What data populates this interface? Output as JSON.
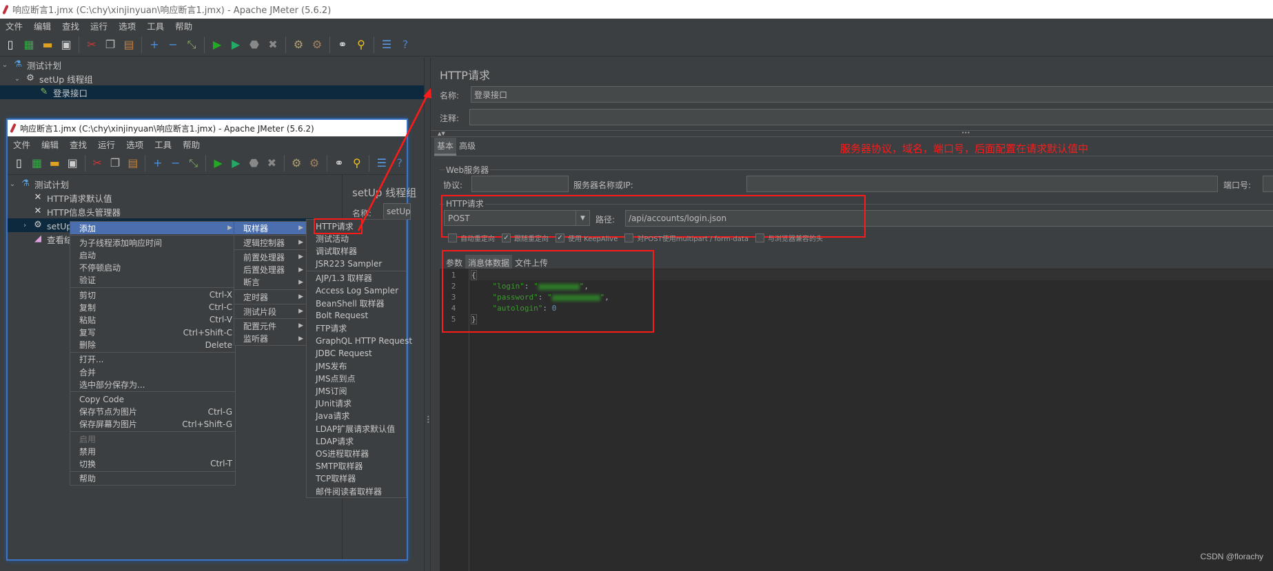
{
  "window": {
    "title": "响应断言1.jmx (C:\\chy\\xinjinyuan\\响应断言1.jmx) - Apache JMeter (5.6.2)"
  },
  "menubar": [
    "文件",
    "编辑",
    "查找",
    "运行",
    "选项",
    "工具",
    "帮助"
  ],
  "toolbar": [
    {
      "icon": "new-icon",
      "glyph": "▯",
      "color": "#eeeeee"
    },
    {
      "icon": "templates-icon",
      "glyph": "▦",
      "color": "#3aa84a"
    },
    {
      "icon": "open-icon",
      "glyph": "▬",
      "color": "#e0a020"
    },
    {
      "icon": "save-icon",
      "glyph": "▣",
      "color": "#cccccc"
    },
    {
      "sep": true
    },
    {
      "icon": "cut-icon",
      "glyph": "✂",
      "color": "#e03030"
    },
    {
      "icon": "copy-icon",
      "glyph": "❐",
      "color": "#bbbbbb"
    },
    {
      "icon": "paste-icon",
      "glyph": "▤",
      "color": "#c08040"
    },
    {
      "sep": true
    },
    {
      "icon": "expand-icon",
      "glyph": "+",
      "color": "#4a90e0"
    },
    {
      "icon": "collapse-icon",
      "glyph": "−",
      "color": "#4a90e0"
    },
    {
      "icon": "toggle-icon",
      "glyph": "⤡",
      "color": "#8ab060"
    },
    {
      "sep": true
    },
    {
      "icon": "start-icon",
      "glyph": "▶",
      "color": "#22aa22"
    },
    {
      "icon": "start-no-pause-icon",
      "glyph": "▶",
      "color": "#22aa66"
    },
    {
      "icon": "stop-icon",
      "glyph": "⬣",
      "color": "#888888"
    },
    {
      "icon": "shutdown-icon",
      "glyph": "✖",
      "color": "#888888"
    },
    {
      "sep": true
    },
    {
      "icon": "clear-icon",
      "glyph": "⚙",
      "color": "#b0a070"
    },
    {
      "icon": "clear-all-icon",
      "glyph": "⚙",
      "color": "#a08060"
    },
    {
      "sep": true
    },
    {
      "icon": "search-icon",
      "glyph": "⚭",
      "color": "#dddddd"
    },
    {
      "icon": "reset-search-icon",
      "glyph": "⚲",
      "color": "#f0c020"
    },
    {
      "sep": true
    },
    {
      "icon": "function-helper-icon",
      "glyph": "☰",
      "color": "#5a9ae0"
    },
    {
      "icon": "help-icon",
      "glyph": "?",
      "color": "#4a80d0"
    }
  ],
  "tree": [
    {
      "label": "测试计划",
      "icon": "test-plan-icon",
      "chevron": "⌄"
    },
    {
      "label": "setUp 线程组",
      "icon": "thread-group-icon",
      "chevron": "⌄"
    },
    {
      "label": "登录接口",
      "icon": "sampler-icon",
      "selected": true
    }
  ],
  "inner": {
    "title": "响应断言1.jmx (C:\\chy\\xinjinyuan\\响应断言1.jmx) - Apache JMeter (5.6.2)",
    "tree": [
      {
        "label": "测试计划",
        "icon": "test-plan-icon"
      },
      {
        "label": "HTTP请求默认值",
        "icon": "config-icon"
      },
      {
        "label": "HTTP信息头管理器",
        "icon": "config-icon"
      },
      {
        "label": "setUp 线程组",
        "icon": "thread-group-icon",
        "selected": true
      },
      {
        "label": "查看结果树",
        "icon": "listener-icon"
      }
    ],
    "panel_title": "setUp 线程组",
    "name_label": "名称:",
    "name_value": "setUp"
  },
  "context_menu": [
    {
      "label": "添加",
      "submenu": true,
      "highlighted": true
    },
    {
      "sep": true
    },
    {
      "label": "为子线程添加响应时间"
    },
    {
      "label": "启动"
    },
    {
      "label": "不停顿启动"
    },
    {
      "label": "验证"
    },
    {
      "sep": true
    },
    {
      "label": "剪切",
      "shortcut": "Ctrl-X"
    },
    {
      "label": "复制",
      "shortcut": "Ctrl-C"
    },
    {
      "label": "粘贴",
      "shortcut": "Ctrl-V"
    },
    {
      "label": "复写",
      "shortcut": "Ctrl+Shift-C"
    },
    {
      "label": "删除",
      "shortcut": "Delete"
    },
    {
      "sep": true
    },
    {
      "label": "打开..."
    },
    {
      "label": "合并"
    },
    {
      "label": "选中部分保存为..."
    },
    {
      "sep": true
    },
    {
      "label": "Copy Code"
    },
    {
      "label": "保存节点为图片",
      "shortcut": "Ctrl-G"
    },
    {
      "label": "保存屏幕为图片",
      "shortcut": "Ctrl+Shift-G"
    },
    {
      "sep": true
    },
    {
      "label": "启用",
      "disabled": true
    },
    {
      "label": "禁用"
    },
    {
      "label": "切换",
      "shortcut": "Ctrl-T"
    },
    {
      "sep": true
    },
    {
      "label": "帮助"
    }
  ],
  "add_submenu": [
    {
      "label": "取样器",
      "submenu": true,
      "highlighted": true
    },
    {
      "sep": true
    },
    {
      "label": "逻辑控制器",
      "submenu": true
    },
    {
      "sep": true
    },
    {
      "label": "前置处理器",
      "submenu": true
    },
    {
      "label": "后置处理器",
      "submenu": true
    },
    {
      "label": "断言",
      "submenu": true
    },
    {
      "sep": true
    },
    {
      "label": "定时器",
      "submenu": true
    },
    {
      "sep": true
    },
    {
      "label": "测试片段",
      "submenu": true
    },
    {
      "sep": true
    },
    {
      "label": "配置元件",
      "submenu": true
    },
    {
      "label": "监听器",
      "submenu": true
    }
  ],
  "sampler_submenu": [
    {
      "label": "HTTP请求",
      "boxed": true
    },
    {
      "label": "测试活动"
    },
    {
      "label": "调试取样器"
    },
    {
      "label": "JSR223 Sampler"
    },
    {
      "sep": true
    },
    {
      "label": "AJP/1.3 取样器"
    },
    {
      "label": "Access Log Sampler"
    },
    {
      "label": "BeanShell 取样器"
    },
    {
      "label": "Bolt Request"
    },
    {
      "label": "FTP请求"
    },
    {
      "label": "GraphQL HTTP Request"
    },
    {
      "label": "JDBC Request"
    },
    {
      "label": "JMS发布"
    },
    {
      "label": "JMS点到点"
    },
    {
      "label": "JMS订阅"
    },
    {
      "label": "JUnit请求"
    },
    {
      "label": "Java请求"
    },
    {
      "label": "LDAP扩展请求默认值"
    },
    {
      "label": "LDAP请求"
    },
    {
      "label": "OS进程取样器"
    },
    {
      "label": "SMTP取样器"
    },
    {
      "label": "TCP取样器"
    },
    {
      "label": "邮件阅读者取样器"
    }
  ],
  "panel": {
    "title": "HTTP请求",
    "name_label": "名称:",
    "name_value": "登录接口",
    "comment_label": "注释:",
    "comment_value": "",
    "tabs": [
      {
        "label": "基本",
        "active": true
      },
      {
        "label": "高级"
      }
    ],
    "annotation": "服务器协议，域名，端口号，后面配置在请求默认值中",
    "web_server": {
      "legend": "Web服务器",
      "protocol_label": "协议:",
      "protocol_value": "",
      "server_label": "服务器名称或IP:",
      "server_value": "",
      "port_label": "端口号:",
      "port_value": ""
    },
    "http_request": {
      "legend": "HTTP请求",
      "method": "POST",
      "path_label": "路径:",
      "path_value": "/api/accounts/login.json"
    },
    "checkboxes": [
      {
        "label": "自动重定向",
        "checked": false
      },
      {
        "label": "跟随重定向",
        "checked": true
      },
      {
        "label": "使用 KeepAlive",
        "checked": true
      },
      {
        "label": "对POST使用multipart / form-data",
        "checked": false
      },
      {
        "label": "与浏览器兼容的头",
        "checked": false
      }
    ],
    "body_tabs": [
      {
        "label": "参数"
      },
      {
        "label": "消息体数据",
        "active": true
      },
      {
        "label": "文件上传"
      }
    ],
    "body_lines": [
      "1",
      "2",
      "3",
      "4",
      "5"
    ],
    "body": {
      "open": "{",
      "login_key": "\"login\"",
      "password_key": "\"password\"",
      "autologin_key": "\"autologin\"",
      "autologin_value": "0",
      "close": "}"
    }
  },
  "watermark": "CSDN @florachy",
  "colors": {
    "background": "#3c3f41",
    "selection": "#0d293e",
    "menu_highlight": "#4b6eaf",
    "annotation_red": "#ff1a1a",
    "string_green": "#3c9a2e"
  }
}
